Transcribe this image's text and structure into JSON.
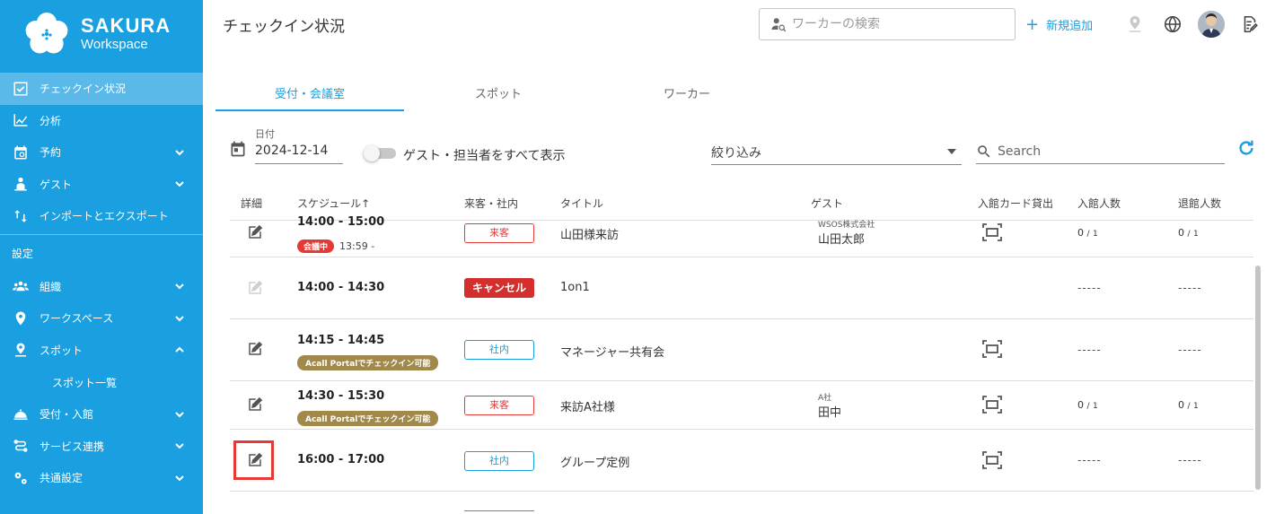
{
  "brand": {
    "name": "SAKURA",
    "sub": "Workspace"
  },
  "sidebar": {
    "items": [
      {
        "label": "チェックイン状況",
        "icon": "checkbox-icon",
        "active": true
      },
      {
        "label": "分析",
        "icon": "chart-icon"
      },
      {
        "label": "予約",
        "icon": "calendar-icon",
        "expand": "down"
      },
      {
        "label": "ゲスト",
        "icon": "guest-icon",
        "expand": "down"
      },
      {
        "label": "インポートとエクスポート",
        "icon": "import-export-icon"
      }
    ],
    "section_label": "設定",
    "settings_items": [
      {
        "label": "組織",
        "icon": "people-icon",
        "expand": "down"
      },
      {
        "label": "ワークスペース",
        "icon": "location-pin-icon",
        "expand": "down"
      },
      {
        "label": "スポット",
        "icon": "spot-pin-icon",
        "expand": "up"
      }
    ],
    "sub_item": "スポット一覧",
    "bottom_items": [
      {
        "label": "受付・入館",
        "icon": "reception-icon",
        "expand": "down"
      },
      {
        "label": "サービス連携",
        "icon": "integration-icon",
        "expand": "down"
      },
      {
        "label": "共通設定",
        "icon": "gears-icon",
        "expand": "down"
      }
    ]
  },
  "header": {
    "title": "チェックイン状況",
    "search_placeholder": "ワーカーの検索",
    "add_label": "新規追加"
  },
  "tabs": [
    {
      "label": "受付・会議室",
      "active": true
    },
    {
      "label": "スポット"
    },
    {
      "label": "ワーカー"
    }
  ],
  "filters": {
    "date_label": "日付",
    "date_value": "2024-12-14",
    "toggle_label": "ゲスト・担当者をすべて表示",
    "toggle_on": false,
    "filter_placeholder": "絞り込み",
    "search_placeholder": "Search"
  },
  "table": {
    "headers": [
      "詳細",
      "スケジュール",
      "来客・社内",
      "タイトル",
      "ゲスト",
      "入館カード貸出",
      "入館人数",
      "退館人数"
    ],
    "sort_arrow": "↑",
    "rows": [
      {
        "time": "14:00 - 15:00",
        "badge": "会議中",
        "badge_time": "13:59 -",
        "type": "来客",
        "type_style": "guest",
        "title": "山田様来訪",
        "guest_company": "WSOS株式会社",
        "guest_name": "山田太郎",
        "card": true,
        "in": "0",
        "in_total": "1",
        "out": "0",
        "out_total": "1"
      },
      {
        "time": "14:00 - 14:30",
        "badge": "",
        "type": "キャンセル",
        "type_style": "cancel",
        "title": "1on1",
        "guest_company": "",
        "guest_name": "",
        "card": false,
        "in_dash": "-----",
        "out_dash": "-----",
        "disabled": true
      },
      {
        "time": "14:15 - 14:45",
        "badge": "Acall Portalでチェックイン可能",
        "type": "社内",
        "type_style": "internal",
        "title": "マネージャー共有会",
        "guest_company": "",
        "guest_name": "",
        "card": true,
        "in_dash": "-----",
        "out_dash": "-----"
      },
      {
        "time": "14:30 - 15:30",
        "badge": "Acall Portalでチェックイン可能",
        "type": "来客",
        "type_style": "guest",
        "title": "来訪A社様",
        "guest_company": "A社",
        "guest_name": "田中",
        "card": true,
        "in": "0",
        "in_total": "1",
        "out": "0",
        "out_total": "1"
      },
      {
        "time": "16:00 - 17:00",
        "badge": "",
        "type": "社内",
        "type_style": "internal",
        "title": "グループ定例",
        "guest_company": "",
        "guest_name": "",
        "card": true,
        "in_dash": "-----",
        "out_dash": "-----"
      }
    ]
  },
  "colors": {
    "primary": "#1a9fe0",
    "sidebar_active": "#5bb9ea",
    "danger": "#e53935",
    "acall_badge": "#a0894a"
  }
}
